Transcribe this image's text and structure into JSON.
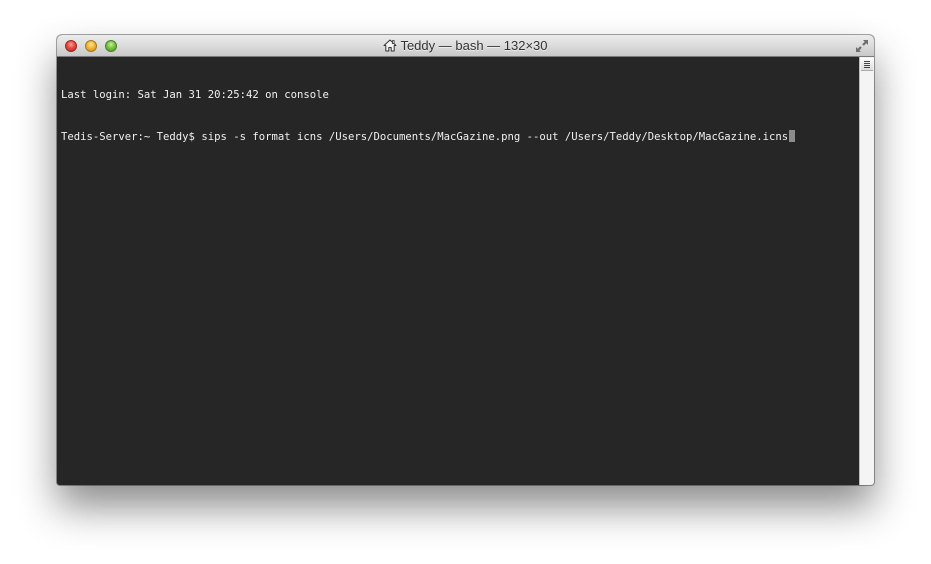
{
  "window": {
    "title": "Teddy — bash — 132×30"
  },
  "terminal": {
    "lines": [
      "Last login: Sat Jan 31 20:25:42 on console",
      "Tedis-Server:~ Teddy$ sips -s format icns /Users/Documents/MacGazine.png --out /Users/Teddy/Desktop/MacGazine.icns"
    ]
  },
  "icons": {
    "title_icon": "home-icon",
    "fullscreen": "fullscreen-icon",
    "split": "split-pane-icon"
  },
  "colors": {
    "terminal_bg": "#262626",
    "terminal_fg": "#f0f0f0",
    "close": "#e84a42",
    "minimize": "#f1b73a",
    "zoom": "#78c443"
  }
}
